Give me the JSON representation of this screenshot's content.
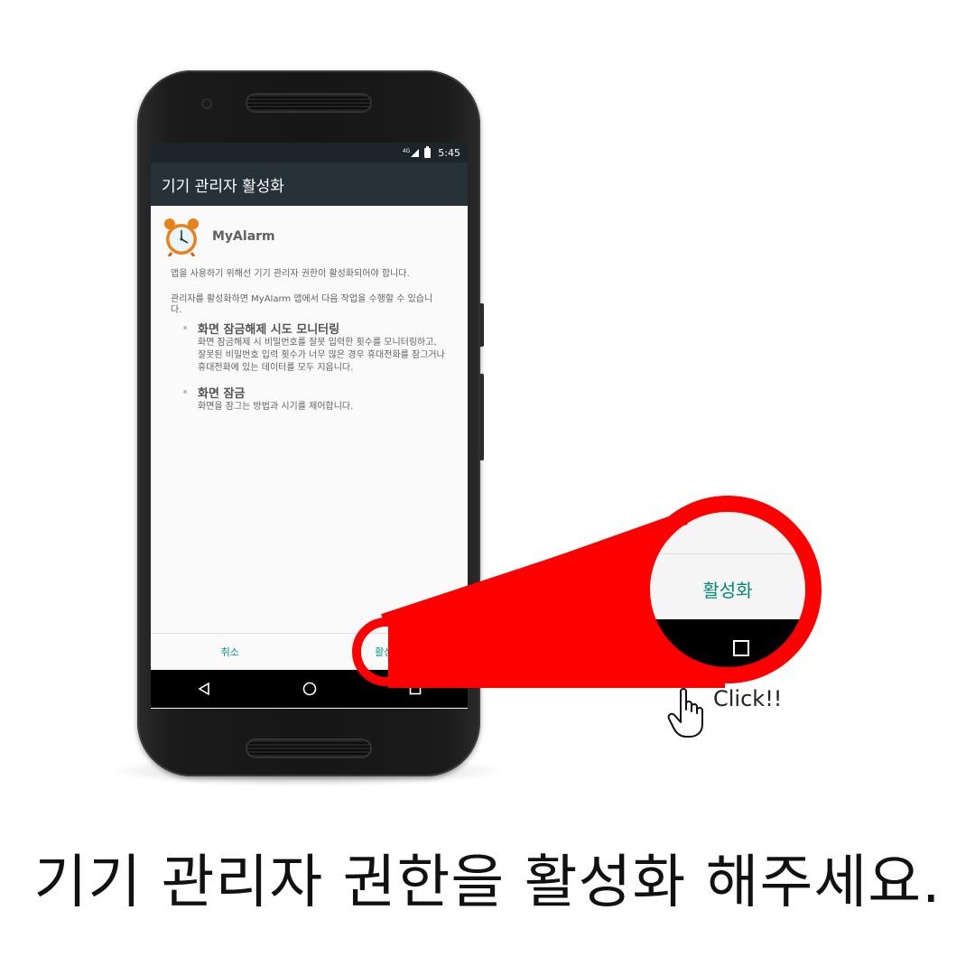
{
  "status_bar": {
    "network": "4G",
    "time": "5:45"
  },
  "toolbar": {
    "title": "기기 관리자 활성화"
  },
  "app": {
    "name": "MyAlarm",
    "icon": "alarm-clock-icon"
  },
  "body": {
    "paragraph1": "앱을 사용하기 위해선 기기 관리자 권한이 활성화되어야 합니다.",
    "paragraph2": "관리자를 활성화하면 MyAlarm 앱에서 다음 작업을 수행할 수 있습니다.",
    "policies": [
      {
        "title": "화면 잠금해제 시도 모니터링",
        "description": "화면 잠금해제 시 비밀번호를 잘못 입력한 횟수를 모니터링하고, 잘못된 비밀번호 입력 횟수가 너무 많은 경우 휴대전화를 잠그거나 휴대전화에 있는 데이터를 모두 지웁니다."
      },
      {
        "title": "화면 잠금",
        "description": "화면을 잠그는 방법과 시기를 제어합니다."
      }
    ]
  },
  "buttons": {
    "cancel": "취소",
    "activate": "활성화"
  },
  "nav": {
    "back_icon": "back-triangle-icon",
    "home_icon": "home-circle-icon",
    "recents_icon": "recents-square-icon"
  },
  "zoom": {
    "label": "활성화",
    "click_text": "Click!!"
  },
  "caption": "기기 관리자 권한을 활성화 해주세요.",
  "colors": {
    "accent": "#009688",
    "toolbar": "#263238",
    "status": "#1c2529",
    "highlight": "#ff0000"
  }
}
